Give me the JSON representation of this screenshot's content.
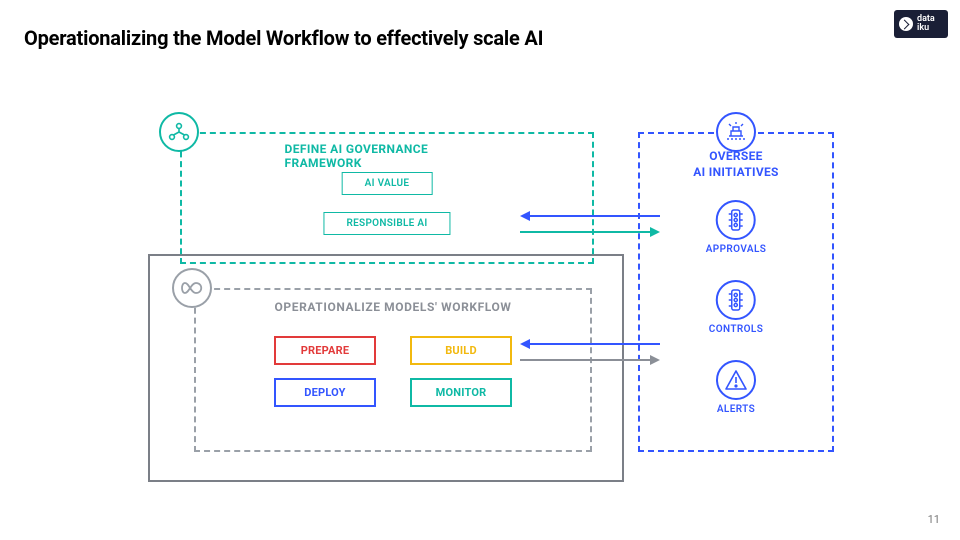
{
  "title": "Operationalizing the Model Workflow to effectively scale AI",
  "page_number": "11",
  "logo_text": "data\niku",
  "governance": {
    "heading": "DEFINE AI GOVERNANCE FRAMEWORK",
    "chips": [
      "AI VALUE",
      "RESPONSIBLE AI"
    ]
  },
  "models": {
    "heading": "OPERATIONALIZE  MODELS' WORKFLOW",
    "chips": {
      "prepare": "PREPARE",
      "build": "BUILD",
      "deploy": "DEPLOY",
      "monitor": "MONITOR"
    }
  },
  "oversee": {
    "heading_line1": "OVERSEE",
    "heading_line2": "AI INITIATIVES",
    "items": [
      {
        "label": "APPROVALS"
      },
      {
        "label": "CONTROLS"
      },
      {
        "label": "ALERTS"
      }
    ]
  }
}
